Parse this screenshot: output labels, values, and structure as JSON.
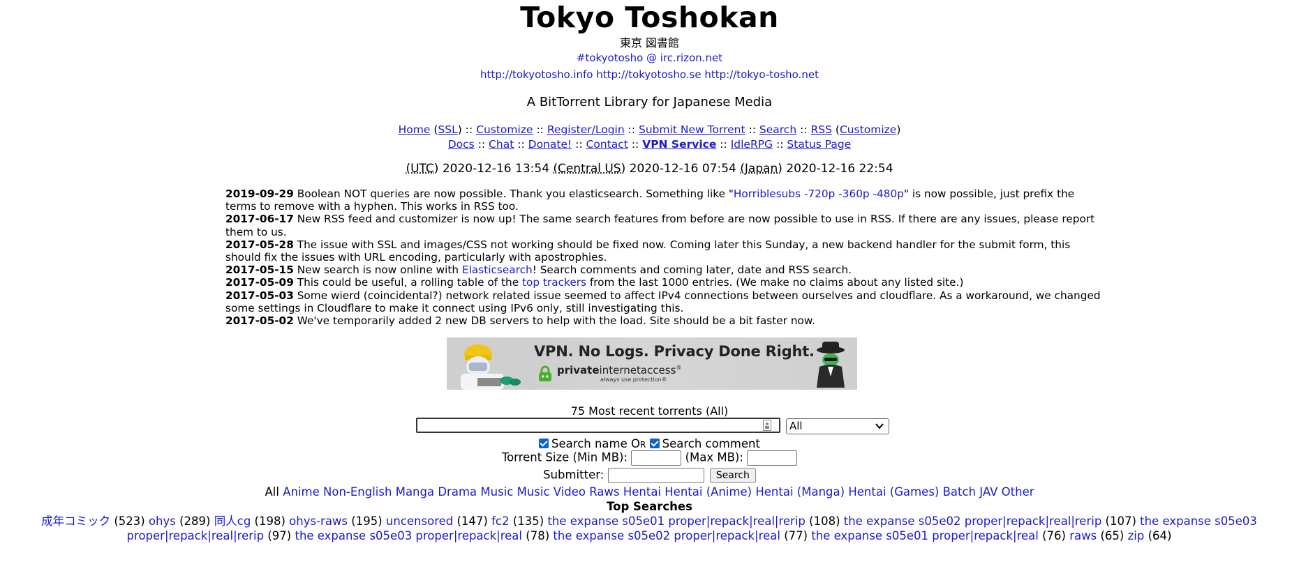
{
  "header": {
    "title": "Tokyo Toshokan",
    "subtitle": "東京 図書館",
    "irc": "#tokyotosho @ irc.rizon.net",
    "mirrors": [
      "http://tokyotosho.info",
      "http://tokyotosho.se",
      "http://tokyo-tosho.net"
    ],
    "tagline": "A BitTorrent Library for Japanese Media"
  },
  "nav": {
    "home": "Home",
    "ssl": "SSL",
    "customize": "Customize",
    "register": "Register/Login",
    "submit": "Submit New Torrent",
    "search": "Search",
    "rss": "RSS",
    "rss_customize": "Customize",
    "docs": "Docs",
    "chat": "Chat",
    "donate": "Donate!",
    "contact": "Contact",
    "vpn": "VPN Service",
    "idlerpg": "IdleRPG",
    "status": "Status Page"
  },
  "clock": {
    "utc_label": "(UTC)",
    "utc": "2020-12-16 13:54",
    "central_label": "(Central US)",
    "central": "2020-12-16 07:54",
    "japan_label": "(Japan)",
    "japan": "2020-12-16 22:54"
  },
  "news": [
    {
      "date": "2019-09-29",
      "pre": " Boolean NOT queries are now possible. Thank you elasticsearch. Something like \"",
      "link": "Horriblesubs -720p -360p -480p",
      "post": "\" is now possible, just prefix the terms to remove with a hyphen. This works in RSS too."
    },
    {
      "date": "2017-06-17",
      "pre": " New RSS feed and customizer is now up! The same search features from before are now possible to use in RSS. If there are any issues, please report them to us.",
      "link": "",
      "post": ""
    },
    {
      "date": "2017-05-28",
      "pre": " The issue with SSL and images/CSS not working should be fixed now. Coming later this Sunday, a new backend handler for the submit form, this should fix the issues with URL encoding, particularly with apostrophies.",
      "link": "",
      "post": ""
    },
    {
      "date": "2017-05-15",
      "pre": " New search is now online with ",
      "link": "Elasticsearch",
      "post": "! Search comments and coming later, date and RSS search."
    },
    {
      "date": "2017-05-09",
      "pre": " This could be useful, a rolling table of the ",
      "link": "top trackers",
      "post": " from the last 1000 entries. (We make no claims about any listed site.)"
    },
    {
      "date": "2017-05-03",
      "pre": " Some wierd (coincidental?) network related issue seemed to affect IPv4 connections between ourselves and cloudflare. As a workaround, we changed some settings in Cloudflare to make it connect using IPv6 only, still investigating this.",
      "link": "",
      "post": ""
    },
    {
      "date": "2017-05-02",
      "pre": " We've temporarily added 2 new DB servers to help with the load. Site should be a bit faster now.",
      "link": "",
      "post": ""
    }
  ],
  "ad": {
    "headline": "VPN. No Logs. Privacy Done Right.",
    "brand_bold": "private",
    "brand_rest": "internetaccess",
    "reg": "®",
    "sub": "always use protection®"
  },
  "search": {
    "recent_label": "75 Most recent torrents (All)",
    "category_value": "All",
    "search_name": "Search name",
    "or_word": "Or",
    "search_comment": "Search comment",
    "size_label_min": "Torrent Size (Min MB):",
    "size_label_max": "(Max MB):",
    "submitter_label": "Submitter:",
    "button": "Search"
  },
  "categories": {
    "all": "All",
    "items": [
      "Anime",
      "Non-English",
      "Manga",
      "Drama",
      "Music",
      "Music Video",
      "Raws",
      "Hentai",
      "Hentai (Anime)",
      "Hentai (Manga)",
      "Hentai (Games)",
      "Batch",
      "JAV",
      "Other"
    ]
  },
  "top_searches": {
    "title": "Top Searches",
    "items": [
      {
        "term": "成年コミック",
        "count": "(523)"
      },
      {
        "term": "ohys",
        "count": "(289)"
      },
      {
        "term": "同人cg",
        "count": "(198)"
      },
      {
        "term": "ohys-raws",
        "count": "(195)"
      },
      {
        "term": "uncensored",
        "count": "(147)"
      },
      {
        "term": "fc2",
        "count": "(135)"
      },
      {
        "term": "the expanse s05e01 proper|repack|real|rerip",
        "count": "(108)"
      },
      {
        "term": "the expanse s05e02 proper|repack|real|rerip",
        "count": "(107)"
      },
      {
        "term": "the expanse s05e03 proper|repack|real|rerip",
        "count": "(97)"
      },
      {
        "term": "the expanse s05e03 proper|repack|real",
        "count": "(78)"
      },
      {
        "term": "the expanse s05e02 proper|repack|real",
        "count": "(77)"
      },
      {
        "term": "the expanse s05e01 proper|repack|real",
        "count": "(76)"
      },
      {
        "term": "raws",
        "count": "(65)"
      },
      {
        "term": "zip",
        "count": "(64)"
      }
    ]
  }
}
